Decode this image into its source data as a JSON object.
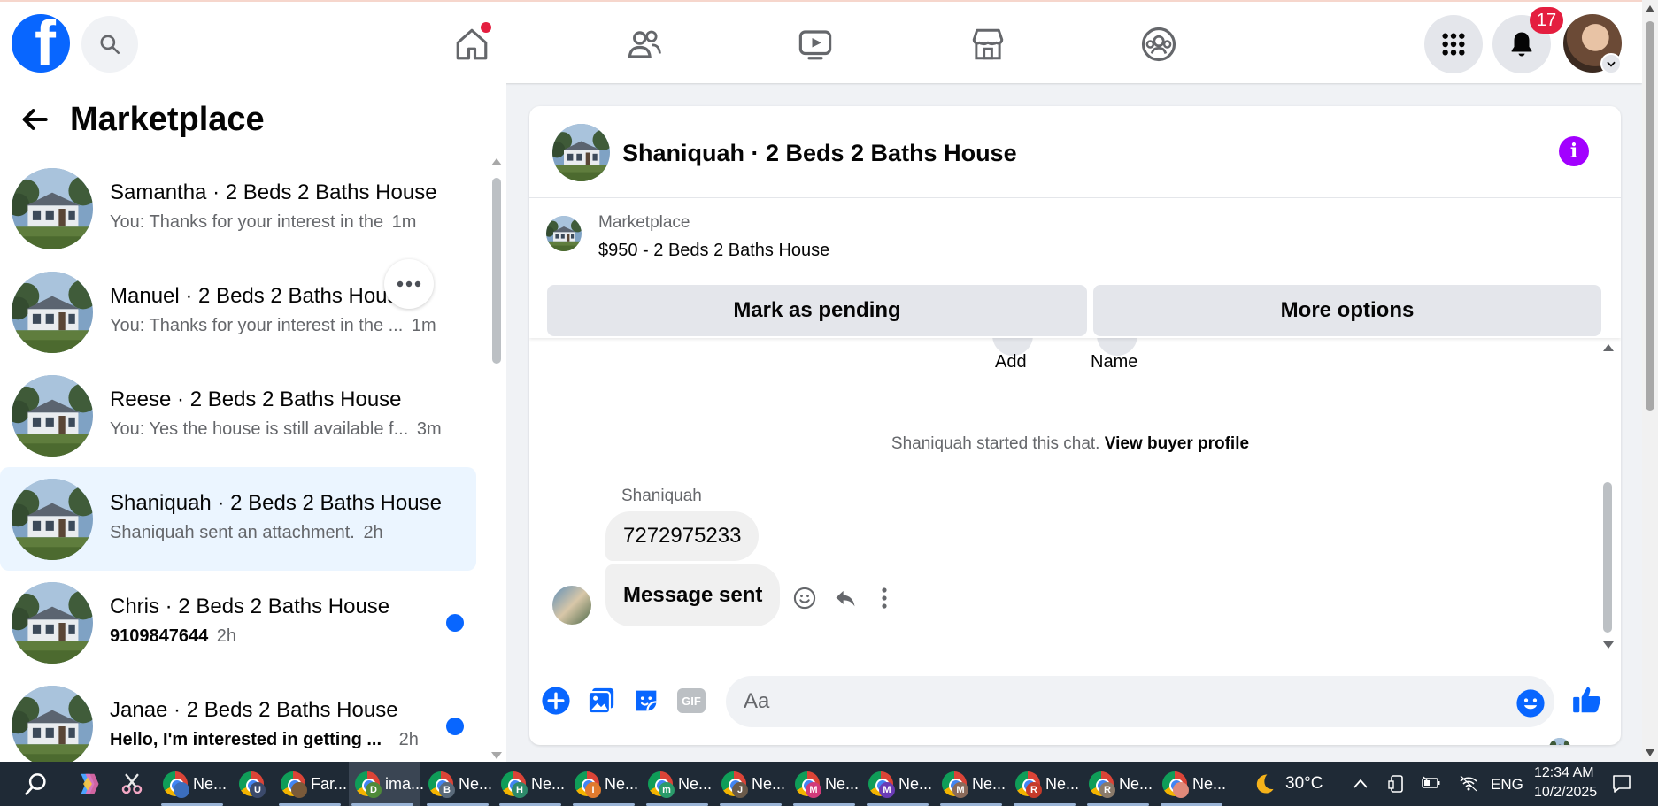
{
  "topbar": {
    "logo_letter": "f",
    "notifications_count": "17"
  },
  "sidebar": {
    "title": "Marketplace",
    "conversations": [
      {
        "name": "Samantha · 2 Beds 2 Baths House",
        "preview": "You: Thanks for your interest in the",
        "time": "1m",
        "unread": false
      },
      {
        "name": "Manuel · 2 Beds 2 Baths House",
        "preview": "You: Thanks for your interest in the ...",
        "time": "1m",
        "unread": false
      },
      {
        "name": "Reese · 2 Beds 2 Baths House",
        "preview": "You: Yes the house is still available f...",
        "time": "3m",
        "unread": false
      },
      {
        "name": "Shaniquah · 2 Beds 2 Baths House",
        "preview": "Shaniquah sent an attachment.",
        "time": "2h",
        "unread": false,
        "active": true
      },
      {
        "name": "Chris · 2 Beds 2 Baths House",
        "preview": "9109847644",
        "time": "2h",
        "unread": true
      },
      {
        "name": "Janae · 2 Beds 2 Baths House",
        "preview": "Hello, I'm interested in getting ...",
        "time": "2h",
        "unread": true
      }
    ]
  },
  "chat": {
    "title": "Shaniquah · 2 Beds 2 Baths House",
    "listing_category": "Marketplace",
    "listing_price_title": "$950 - 2 Beds 2 Baths House",
    "mark_pending_label": "Mark as pending",
    "more_options_label": "More options",
    "action_add_label": "Add",
    "action_name_label": "Name",
    "started_text": "Shaniquah started this chat.",
    "view_profile_label": "View buyer profile",
    "sender_name": "Shaniquah",
    "messages": [
      "7272975233",
      "Message sent"
    ],
    "input_placeholder": "Aa"
  },
  "taskbar": {
    "apps": [
      "Ne...",
      "Far...",
      "ima...",
      "Ne...",
      "Ne...",
      "Ne...",
      "Ne...",
      "Ne...",
      "Ne...",
      "Ne...",
      "Ne...",
      "Ne...",
      "Ne...",
      "Ne..."
    ],
    "profile_letters": [
      "",
      "U",
      "",
      "D",
      "B",
      "H",
      "I",
      "m",
      "J",
      "M",
      "M",
      "M",
      "R",
      "R",
      ""
    ],
    "weather": "30°C",
    "language": "ENG",
    "time": "12:34 AM",
    "date": "10/2/2025"
  },
  "colors": {
    "brand_blue": "#0866ff",
    "info_purple": "#a200ff",
    "badge_red": "#e41e3f",
    "active_conversation_bg": "#ebf5ff"
  }
}
